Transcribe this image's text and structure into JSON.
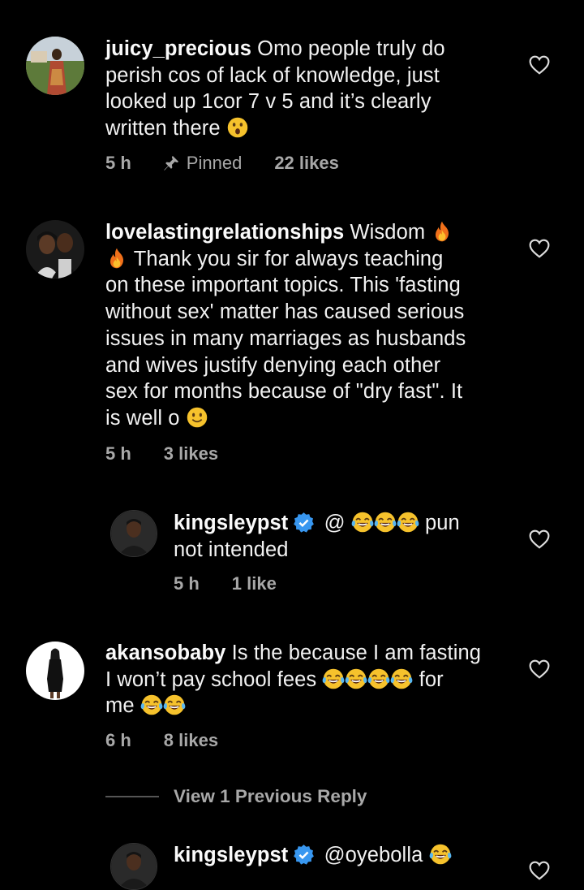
{
  "comments": [
    {
      "username": "juicy_precious",
      "text_lines": [
        "Omo people truly do",
        "perish cos of lack of knowledge, just",
        "looked up 1cor 7 v 5 and it’s clearly",
        "written there"
      ],
      "time": "5 h",
      "pinned_label": "Pinned",
      "likes": "22 likes"
    },
    {
      "username": "lovelastingrelationships",
      "text_first": "Wisdom",
      "text_lines": [
        "Thank you sir for always teaching",
        "on these important topics. This 'fasting",
        "without sex' matter has caused serious",
        "issues in many marriages as husbands",
        "and wives justify denying each other",
        "sex for months because of \"dry fast\". It",
        "is well o"
      ],
      "time": "5 h",
      "likes": "3 likes"
    },
    {
      "username": "kingsleypst",
      "text_first": "@",
      "text_after": "pun",
      "text_line2": "not intended",
      "time": "5 h",
      "likes": "1 like"
    },
    {
      "username": "akansobaby",
      "text_first": "Is the because I am fasting",
      "text_line2_a": "I won’t pay school fees",
      "text_line2_b": "for",
      "text_line3": "me",
      "time": "6 h",
      "likes": "8 likes"
    },
    {
      "username": "kingsleypst",
      "text_first": "@oyebolla"
    }
  ],
  "view_replies_label": "View 1 Previous Reply",
  "icons": {
    "like": "heart-outline-icon",
    "pin": "pin-icon",
    "verified": "verified-badge-icon",
    "emoji_surprised": "surprised-face-emoji",
    "emoji_fire": "fire-emoji",
    "emoji_smile": "slight-smile-emoji",
    "emoji_laugh": "tears-of-joy-emoji"
  },
  "colors": {
    "background": "#000000",
    "secondary_text": "#a8a8a8",
    "verified": "#3897f0"
  }
}
